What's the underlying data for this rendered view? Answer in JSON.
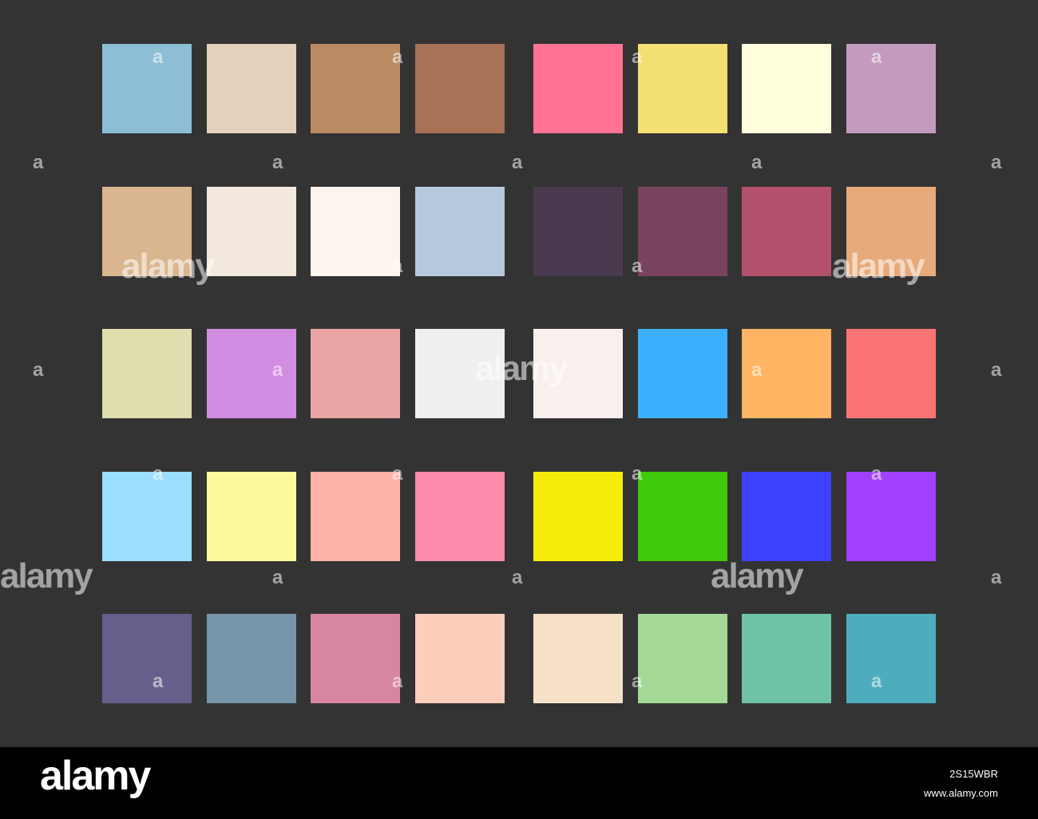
{
  "palette": {
    "rows": [
      [
        "#8dbed5",
        "#e3d1bc",
        "#bb8b64",
        "#a77256",
        "#fe7393",
        "#f3e071",
        "#fffedd",
        "#c49bbf"
      ],
      [
        "#d9b68f",
        "#f3e9df",
        "#fdf5ed",
        "#b7c9de",
        "#4a3a4f",
        "#78435e",
        "#b3516c",
        "#e7aa7b"
      ],
      [
        "#e0ddaf",
        "#d28ce2",
        "#e9a5a4",
        "#efefef",
        "#f9f0ee",
        "#3cb0fe",
        "#ffb463",
        "#fa7475"
      ],
      [
        "#9adfff",
        "#fdf89a",
        "#ffb2a6",
        "#fd8bac",
        "#f6ec0c",
        "#40c80a",
        "#3d41fe",
        "#a141fd"
      ],
      [
        "#665f8c",
        "#7796ab",
        "#d785a1",
        "#fccebc",
        "#f6e1c8",
        "#a3d896",
        "#6ec3a5",
        "#4dadbd"
      ]
    ]
  },
  "footer": {
    "brand": "alamy",
    "image_id": "2S15WBR",
    "site_url": "www.alamy.com"
  },
  "watermark": {
    "text_large": "alamy",
    "text_small": "a"
  }
}
